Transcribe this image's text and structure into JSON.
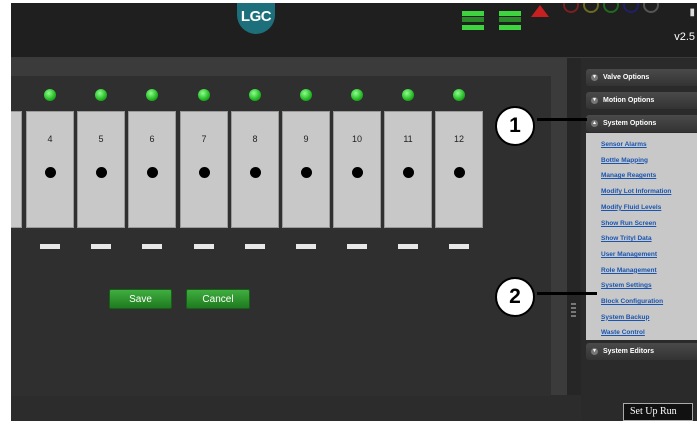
{
  "header": {
    "logo_text": "LGC",
    "version": "v2.5",
    "status_icon": "alert-triangle-icon"
  },
  "block": {
    "well_numbers": [
      "",
      "4",
      "5",
      "6",
      "7",
      "8",
      "9",
      "10",
      "11",
      "12"
    ],
    "save_label": "Save",
    "cancel_label": "Cancel"
  },
  "sidebar": {
    "sections": {
      "valve": "Valve Options",
      "motion": "Motion Options",
      "system": "System Options",
      "editors": "System Editors"
    },
    "system_items": [
      "Sensor Alarms",
      "Bottle Mapping",
      "Manage Reagents",
      "Modify Lot Information",
      "Modify Fluid Levels",
      "Show Run Screen",
      "Show Trityl Data",
      "User Management",
      "Role Management",
      "System Settings",
      "Block Configuration",
      "System Backup",
      "Waste Control"
    ]
  },
  "footer": {
    "setup_run": "Set Up Run"
  },
  "callouts": [
    "1",
    "2"
  ],
  "colors": {
    "accent_green": "#2a9a2a",
    "logo_teal": "#1d6f7c",
    "link_blue": "#1a55b0"
  }
}
